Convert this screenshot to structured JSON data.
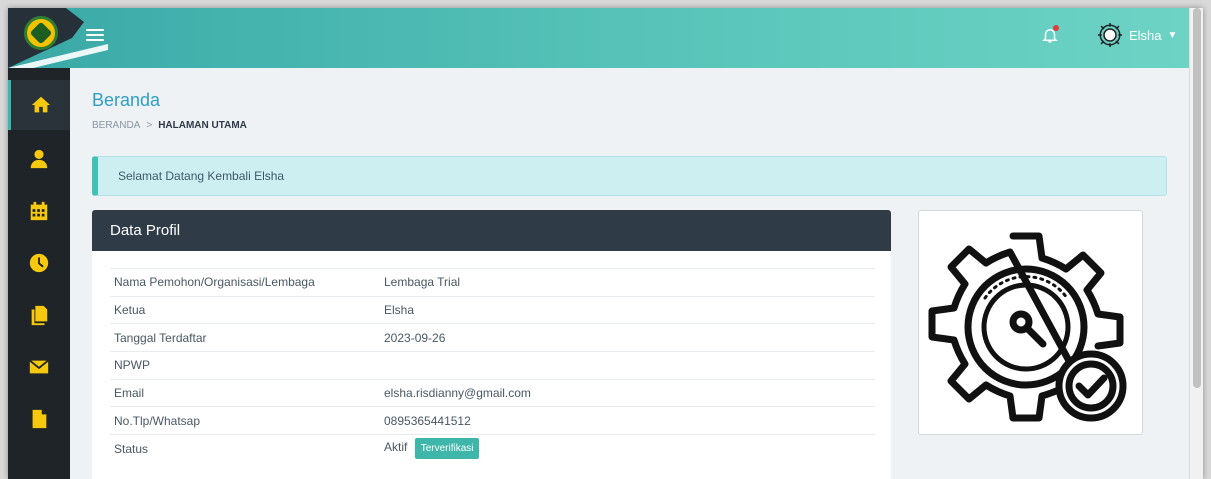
{
  "header": {
    "menu_icon": "hamburger-icon",
    "bell_icon": "bell-icon",
    "user_name": "Elsha",
    "user_menu_icon": "chevron-down-icon"
  },
  "sidebar": {
    "items": [
      {
        "icon": "home-icon",
        "active": true
      },
      {
        "icon": "user-icon",
        "active": false
      },
      {
        "icon": "calendar-icon",
        "active": false
      },
      {
        "icon": "clock-icon",
        "active": false
      },
      {
        "icon": "copy-icon",
        "active": false
      },
      {
        "icon": "envelope-icon",
        "active": false
      },
      {
        "icon": "file-icon",
        "active": false
      }
    ],
    "accent_color": "#f6c90e"
  },
  "page": {
    "title": "Beranda",
    "breadcrumb_root": "BERANDA",
    "breadcrumb_separator": ">",
    "breadcrumb_current": "HALAMAN UTAMA"
  },
  "alert": {
    "message": "Selamat Datang Kembali Elsha"
  },
  "profile": {
    "title": "Data Profil",
    "rows": [
      {
        "label": "Nama Pemohon/Organisasi/Lembaga",
        "value": "Lembaga Trial"
      },
      {
        "label": "Ketua",
        "value": "Elsha"
      },
      {
        "label": "Tanggal Terdaftar",
        "value": "2023-09-26"
      },
      {
        "label": "NPWP",
        "value": ""
      },
      {
        "label": "Email",
        "value": "elsha.risdianny@gmail.com"
      },
      {
        "label": "No.Tlp/Whatsap",
        "value": "0895365441512"
      },
      {
        "label": "Status",
        "value": "Aktif",
        "badge": "Terverifikasi"
      }
    ]
  },
  "illustration": {
    "icon": "gear-gauge-check-icon"
  },
  "colors": {
    "brand_teal": "#3aa9a7",
    "sidebar_bg": "#1f2429",
    "card_header": "#2f3c48",
    "badge": "#3fb6aa"
  }
}
